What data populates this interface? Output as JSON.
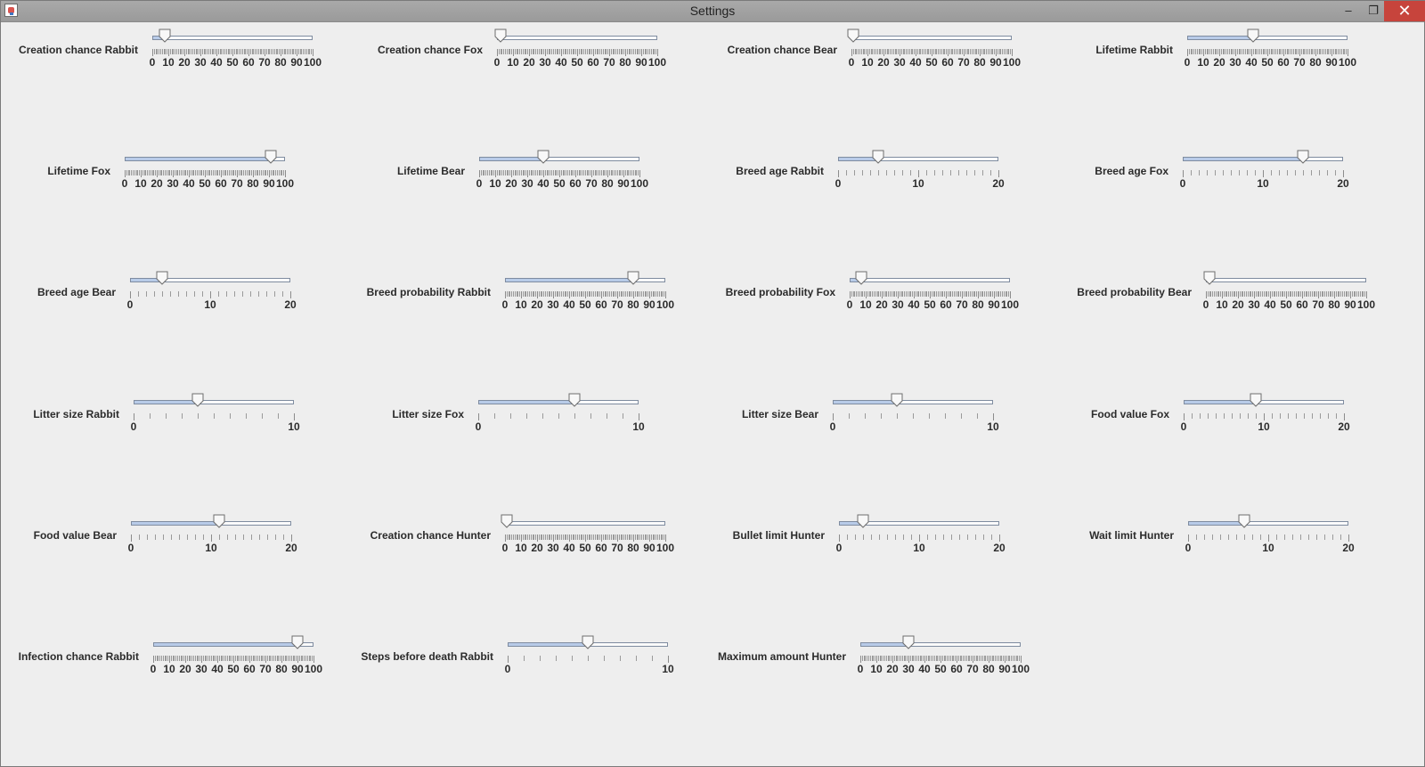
{
  "window": {
    "title": "Settings",
    "minimize_glyph": "–",
    "restore_glyph": "❐",
    "close_glyph": "✕"
  },
  "sliders": [
    {
      "label": "Creation chance Rabbit",
      "value": 8,
      "max": 100,
      "major_ticks": [
        0,
        10,
        20,
        30,
        40,
        50,
        60,
        70,
        80,
        90,
        100
      ]
    },
    {
      "label": "Creation chance Fox",
      "value": 2,
      "max": 100,
      "major_ticks": [
        0,
        10,
        20,
        30,
        40,
        50,
        60,
        70,
        80,
        90,
        100
      ]
    },
    {
      "label": "Creation chance Bear",
      "value": 1,
      "max": 100,
      "major_ticks": [
        0,
        10,
        20,
        30,
        40,
        50,
        60,
        70,
        80,
        90,
        100
      ]
    },
    {
      "label": "Lifetime Rabbit",
      "value": 41,
      "max": 100,
      "major_ticks": [
        0,
        10,
        20,
        30,
        40,
        50,
        60,
        70,
        80,
        90,
        100
      ]
    },
    {
      "label": "Lifetime Fox",
      "value": 91,
      "max": 100,
      "major_ticks": [
        0,
        10,
        20,
        30,
        40,
        50,
        60,
        70,
        80,
        90,
        100
      ]
    },
    {
      "label": "Lifetime Bear",
      "value": 40,
      "max": 100,
      "major_ticks": [
        0,
        10,
        20,
        30,
        40,
        50,
        60,
        70,
        80,
        90,
        100
      ]
    },
    {
      "label": "Breed age Rabbit",
      "value": 5,
      "max": 20,
      "major_ticks": [
        0,
        10,
        20
      ]
    },
    {
      "label": "Breed age Fox",
      "value": 15,
      "max": 20,
      "major_ticks": [
        0,
        10,
        20
      ]
    },
    {
      "label": "Breed age Bear",
      "value": 4,
      "max": 20,
      "major_ticks": [
        0,
        10,
        20
      ]
    },
    {
      "label": "Breed probability Rabbit",
      "value": 80,
      "max": 100,
      "major_ticks": [
        0,
        10,
        20,
        30,
        40,
        50,
        60,
        70,
        80,
        90,
        100
      ]
    },
    {
      "label": "Breed probability Fox",
      "value": 7,
      "max": 100,
      "major_ticks": [
        0,
        10,
        20,
        30,
        40,
        50,
        60,
        70,
        80,
        90,
        100
      ]
    },
    {
      "label": "Breed probability Bear",
      "value": 2,
      "max": 100,
      "major_ticks": [
        0,
        10,
        20,
        30,
        40,
        50,
        60,
        70,
        80,
        90,
        100
      ]
    },
    {
      "label": "Litter size Rabbit",
      "value": 4,
      "max": 10,
      "major_ticks": [
        0,
        10
      ]
    },
    {
      "label": "Litter size Fox",
      "value": 6,
      "max": 10,
      "major_ticks": [
        0,
        10
      ]
    },
    {
      "label": "Litter size Bear",
      "value": 4,
      "max": 10,
      "major_ticks": [
        0,
        10
      ]
    },
    {
      "label": "Food value Fox",
      "value": 9,
      "max": 20,
      "major_ticks": [
        0,
        10,
        20
      ]
    },
    {
      "label": "Food value Bear",
      "value": 11,
      "max": 20,
      "major_ticks": [
        0,
        10,
        20
      ]
    },
    {
      "label": "Creation chance Hunter",
      "value": 1,
      "max": 100,
      "major_ticks": [
        0,
        10,
        20,
        30,
        40,
        50,
        60,
        70,
        80,
        90,
        100
      ]
    },
    {
      "label": "Bullet limit Hunter",
      "value": 3,
      "max": 20,
      "major_ticks": [
        0,
        10,
        20
      ]
    },
    {
      "label": "Wait limit Hunter",
      "value": 7,
      "max": 20,
      "major_ticks": [
        0,
        10,
        20
      ]
    },
    {
      "label": "Infection chance Rabbit",
      "value": 90,
      "max": 100,
      "major_ticks": [
        0,
        10,
        20,
        30,
        40,
        50,
        60,
        70,
        80,
        90,
        100
      ]
    },
    {
      "label": "Steps before death Rabbit",
      "value": 5,
      "max": 10,
      "major_ticks": [
        0,
        10
      ]
    },
    {
      "label": "Maximum amount Hunter",
      "value": 30,
      "max": 100,
      "major_ticks": [
        0,
        10,
        20,
        30,
        40,
        50,
        60,
        70,
        80,
        90,
        100
      ]
    }
  ]
}
